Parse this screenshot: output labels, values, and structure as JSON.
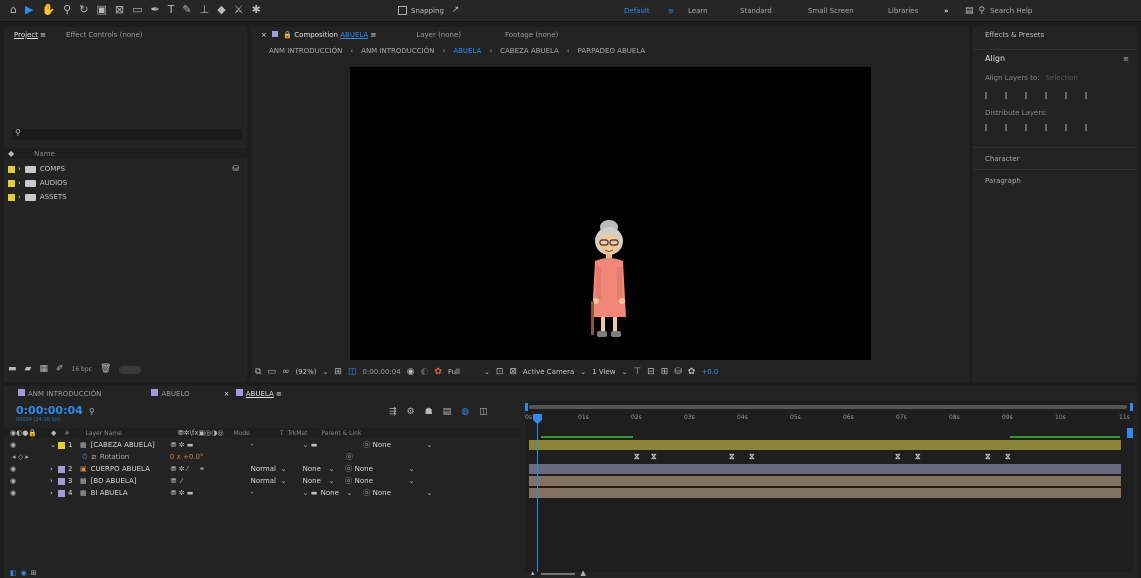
{
  "toolbar": {
    "tools": [
      "home-icon",
      "selection-tool-icon",
      "hand-tool-icon",
      "zoom-tool-icon",
      "rotation-tool-icon",
      "camera-tool-icon",
      "pan-behind-icon",
      "rectangle-tool-icon",
      "pen-tool-icon",
      "type-tool-icon",
      "brush-tool-icon",
      "clone-stamp-icon",
      "eraser-icon",
      "roto-brush-icon",
      "puppet-pin-icon"
    ],
    "snapping_label": "Snapping",
    "workspaces": [
      "Default",
      "Learn",
      "Standard",
      "Small Screen",
      "Libraries"
    ],
    "active_workspace": "Default",
    "search_placeholder": "Search Help"
  },
  "project_panel": {
    "tab_project": "Project",
    "tab_effect_controls": "Effect Controls (none)",
    "column_name": "Name",
    "items": [
      {
        "label": "COMPS"
      },
      {
        "label": "AUDIOS"
      },
      {
        "label": "ASSETS"
      }
    ],
    "bpc_label": "16 bpc"
  },
  "composition_panel": {
    "tab_composition_prefix": "Composition",
    "tab_composition_name": "ABUELA",
    "tab_layer": "Layer (none)",
    "tab_footage": "Footage (none)",
    "breadcrumbs": [
      "ANM INTRODUCCIÓN",
      "ANM INTRODUCCIÓN",
      "ABUELA",
      "CABEZA ABUELA",
      "PARPADEO ABUELA"
    ],
    "zoom": "(92%)",
    "timecode": "0:00:00:04",
    "resolution": "Full",
    "camera": "Active Camera",
    "view": "1 View",
    "exposure": "+0.0"
  },
  "right_panel": {
    "effects_presets": "Effects & Presets",
    "align_title": "Align",
    "align_layers_to_label": "Align Layers to:",
    "align_layers_to_value": "Selection",
    "distribute_label": "Distribute Layers:",
    "character": "Character",
    "paragraph": "Paragraph"
  },
  "timeline": {
    "tabs": [
      {
        "label": "ANM INTRODUCCIÓN",
        "color": "#a09bd6"
      },
      {
        "label": "ABUELO",
        "color": "#a09bd6"
      },
      {
        "label": "ABUELA",
        "color": "#a09bd6"
      }
    ],
    "timecode": "0:00:00:04",
    "timecode_sub": "00004 (24.00 fps)",
    "columns": {
      "index": "#",
      "layer_name": "Layer Name",
      "mode": "Mode",
      "t": "T",
      "trkmat": "TrkMat",
      "parent": "Parent & Link"
    },
    "ruler": [
      "0s",
      "01s",
      "02s",
      "03s",
      "04s",
      "05s",
      "06s",
      "07s",
      "08s",
      "09s",
      "10s",
      "11s"
    ],
    "layers": [
      {
        "num": "1",
        "name": "[CABEZA ABUELA]",
        "color": "#e6d028",
        "mode": "-",
        "trkmat": "",
        "parent": "None"
      },
      {
        "num": "2",
        "name": "CUERPO ABUELA",
        "color": "#a09bd6",
        "mode": "Normal",
        "trkmat": "None",
        "parent": "None"
      },
      {
        "num": "3",
        "name": "[BD ABUELA]",
        "color": "#a09bd6",
        "mode": "Normal",
        "trkmat": "None",
        "parent": "None"
      },
      {
        "num": "4",
        "name": "BI ABUELA",
        "color": "#a09bd6",
        "mode": "-",
        "trkmat": "None",
        "parent": "None"
      }
    ],
    "rotation_label": "Rotation",
    "rotation_value": "0 x +0.0°",
    "colors": {
      "bar_yellow": "#8b8338",
      "bar_purple": "#6b6a80",
      "bar_tan": "#847260",
      "playhead": "#2d8ceb"
    }
  }
}
